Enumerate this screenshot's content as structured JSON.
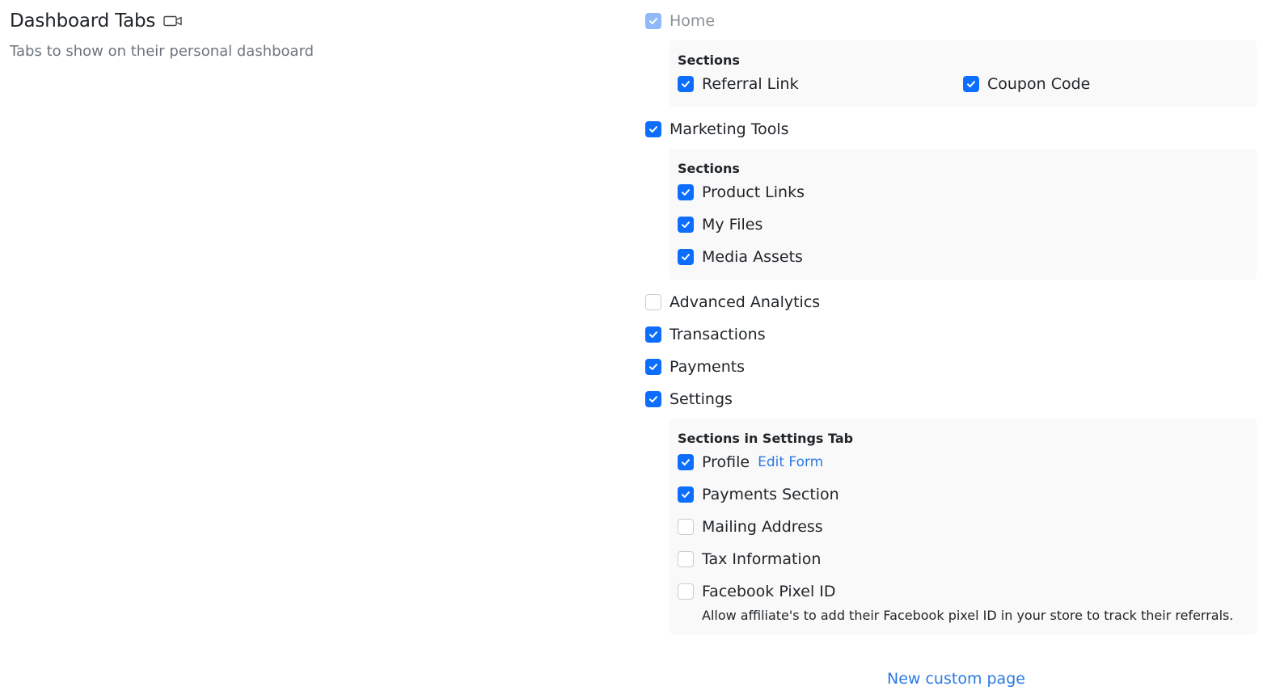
{
  "header": {
    "title": "Dashboard Tabs",
    "subtitle": "Tabs to show on their personal dashboard",
    "title_icon": "video-camera-icon"
  },
  "tabs": {
    "home": {
      "label": "Home",
      "checked": true,
      "disabled": true,
      "sections_heading": "Sections",
      "sections": [
        {
          "label": "Referral Link",
          "checked": true
        },
        {
          "label": "Coupon Code",
          "checked": true
        }
      ]
    },
    "marketing_tools": {
      "label": "Marketing Tools",
      "checked": true,
      "sections_heading": "Sections",
      "sections": [
        {
          "label": "Product Links",
          "checked": true
        },
        {
          "label": "My Files",
          "checked": true
        },
        {
          "label": "Media Assets",
          "checked": true
        }
      ]
    },
    "advanced_analytics": {
      "label": "Advanced Analytics",
      "checked": false
    },
    "transactions": {
      "label": "Transactions",
      "checked": true
    },
    "payments": {
      "label": "Payments",
      "checked": true
    },
    "settings": {
      "label": "Settings",
      "checked": true,
      "sections_heading": "Sections in Settings Tab",
      "profile": {
        "label": "Profile",
        "checked": true,
        "edit_link": "Edit Form"
      },
      "payments_section": {
        "label": "Payments Section",
        "checked": true
      },
      "mailing_address": {
        "label": "Mailing Address",
        "checked": false
      },
      "tax_information": {
        "label": "Tax Information",
        "checked": false
      },
      "facebook_pixel": {
        "label": "Facebook Pixel ID",
        "checked": false,
        "help": "Allow affiliate's to add their Facebook pixel ID in your store to track their referrals."
      }
    }
  },
  "new_custom_page": "New custom page",
  "colors": {
    "accent": "#0d6efd",
    "accent_disabled": "#8fb9f8",
    "link": "#2b79e4",
    "section_bg": "#f9f9f9"
  }
}
